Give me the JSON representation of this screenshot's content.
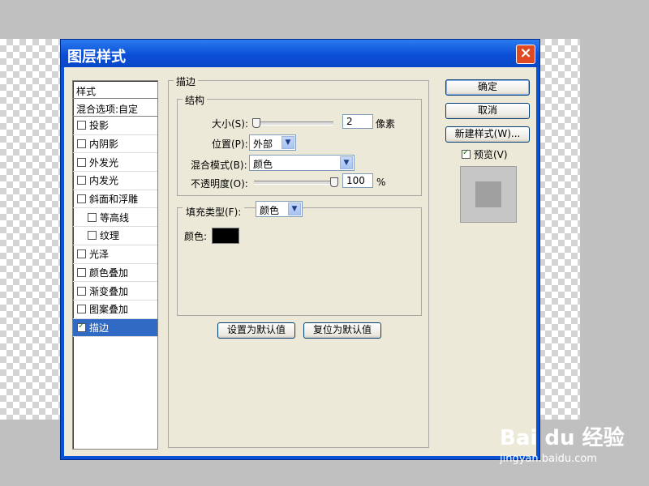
{
  "dialog": {
    "title": "图层样式"
  },
  "styles_list": {
    "header": "样式",
    "blend": "混合选项:自定",
    "items": [
      {
        "label": "投影",
        "checked": false,
        "sub": false
      },
      {
        "label": "内阴影",
        "checked": false,
        "sub": false
      },
      {
        "label": "外发光",
        "checked": false,
        "sub": false
      },
      {
        "label": "内发光",
        "checked": false,
        "sub": false
      },
      {
        "label": "斜面和浮雕",
        "checked": false,
        "sub": false
      },
      {
        "label": "等高线",
        "checked": false,
        "sub": true
      },
      {
        "label": "纹理",
        "checked": false,
        "sub": true
      },
      {
        "label": "光泽",
        "checked": false,
        "sub": false
      },
      {
        "label": "颜色叠加",
        "checked": false,
        "sub": false
      },
      {
        "label": "渐变叠加",
        "checked": false,
        "sub": false
      },
      {
        "label": "图案叠加",
        "checked": false,
        "sub": false
      },
      {
        "label": "描边",
        "checked": true,
        "sub": false,
        "selected": true
      }
    ]
  },
  "stroke": {
    "group": "描边",
    "structure": {
      "group": "结构",
      "size_label": "大小(S):",
      "size_value": "2",
      "size_unit": "像素",
      "position_label": "位置(P):",
      "position_value": "外部",
      "blend_label": "混合模式(B):",
      "blend_value": "颜色",
      "opacity_label": "不透明度(O):",
      "opacity_value": "100",
      "opacity_unit": "%"
    },
    "fill": {
      "type_label": "填充类型(F):",
      "type_value": "颜色",
      "color_label": "颜色:",
      "color_value": "#000000"
    },
    "set_default": "设置为默认值",
    "reset_default": "复位为默认值"
  },
  "buttons": {
    "ok": "确定",
    "cancel": "取消",
    "new_style": "新建样式(W)...",
    "preview_label": "预览(V)",
    "preview_checked": true
  },
  "watermark": {
    "main": "Bai du 经验",
    "sub": "jingyan.baidu.com"
  }
}
